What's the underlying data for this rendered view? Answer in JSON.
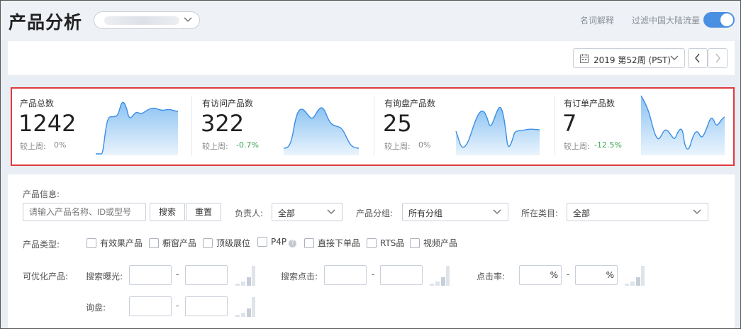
{
  "header": {
    "title": "产品分析",
    "glossary": "名词解释",
    "filter_label": "过滤中国大陆流量",
    "toggle_on": true
  },
  "toolbar": {
    "week": "2019 第52周 (PST)",
    "prev": "‹",
    "next": "›"
  },
  "stats": [
    {
      "label": "产品总数",
      "value": "1242",
      "cmp_label": "较上周:",
      "cmp_value": "0%"
    },
    {
      "label": "有访问产品数",
      "value": "322",
      "cmp_label": "较上周:",
      "cmp_value": "-0.7%"
    },
    {
      "label": "有询盘产品数",
      "value": "25",
      "cmp_label": "较上周:",
      "cmp_value": "0%"
    },
    {
      "label": "有订单产品数",
      "value": "7",
      "cmp_label": "较上周:",
      "cmp_value": "-12.5%"
    }
  ],
  "form": {
    "product_info_label": "产品信息:",
    "search_placeholder": "请输入产品名称、ID或型号",
    "search_btn": "搜索",
    "reset_btn": "重置",
    "owner_label": "负责人:",
    "owner_value": "全部",
    "group_label": "产品分组:",
    "group_value": "所有分组",
    "category_label": "所在类目:",
    "category_value": "全部",
    "type_label": "产品类型:",
    "types": [
      "有效果产品",
      "橱窗产品",
      "顶级展位",
      "P4P",
      "直接下单品",
      "RTS品",
      "视频产品"
    ],
    "optimizable_label": "可优化产品:",
    "impressions_label": "搜索曝光:",
    "clicks_label": "搜索点击:",
    "ctr_label": "点击率:",
    "inquiry_label": "询盘:",
    "range_sep": "-",
    "percent": "%"
  },
  "colors": {
    "accent": "#4a90e2",
    "highlight_border": "#e0393e",
    "negative_change": "#3aa655"
  }
}
